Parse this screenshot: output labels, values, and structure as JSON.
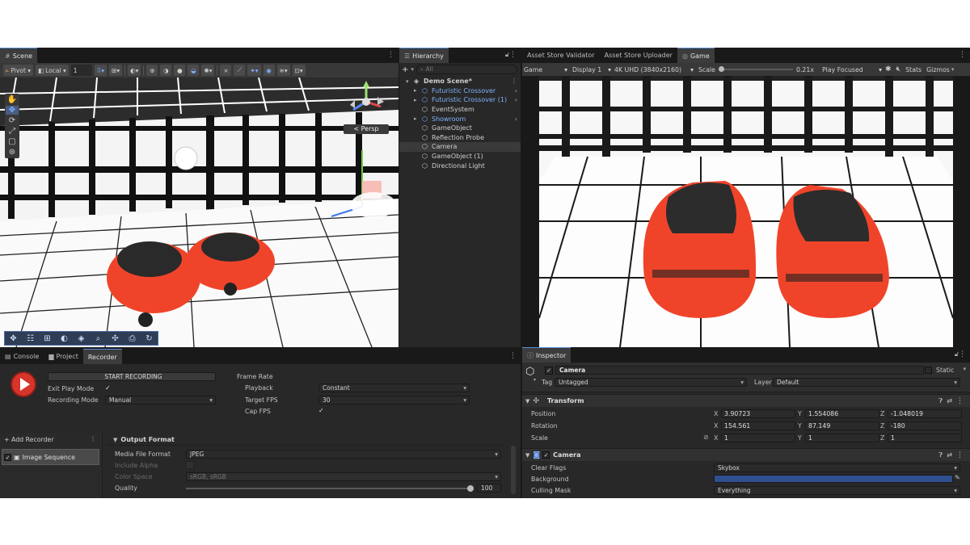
{
  "scene": {
    "tab": "Scene",
    "toolbar": {
      "pivot": "Pivot",
      "local": "Local",
      "grid_snap": "1"
    },
    "persp_label": "< Persp",
    "gizmo_y": "y",
    "gizmo_x": "x"
  },
  "hierarchy": {
    "tab": "Hierarchy",
    "search_placeholder": "All",
    "add_symbol": "+",
    "items": [
      {
        "label": "Demo Scene*",
        "depth": 0,
        "kind": "scene"
      },
      {
        "label": "Futuristic Crossover",
        "depth": 1,
        "kind": "prefab"
      },
      {
        "label": "Futuristic Crossover (1)",
        "depth": 1,
        "kind": "prefab"
      },
      {
        "label": "EventSystem",
        "depth": 1,
        "kind": "go"
      },
      {
        "label": "Showroom",
        "depth": 1,
        "kind": "prefab"
      },
      {
        "label": "GameObject",
        "depth": 1,
        "kind": "go"
      },
      {
        "label": "Reflection Probe",
        "depth": 1,
        "kind": "go"
      },
      {
        "label": "Camera",
        "depth": 1,
        "kind": "go"
      },
      {
        "label": "GameObject (1)",
        "depth": 1,
        "kind": "go"
      },
      {
        "label": "Directional Light",
        "depth": 1,
        "kind": "go"
      }
    ]
  },
  "game": {
    "tabs": [
      "Asset Store Validator",
      "Asset Store Uploader",
      "Game"
    ],
    "toolbar": {
      "mode": "Game",
      "display": "Display 1",
      "resolution": "4K UHD (3840x2160)",
      "scale_label": "Scale",
      "scale_value": "0.21x",
      "play_mode": "Play Focused",
      "stats": "Stats",
      "gizmos": "Gizmos"
    }
  },
  "bottom_tabs": [
    "Console",
    "Project",
    "Recorder"
  ],
  "recorder": {
    "start_label": "START RECORDING",
    "exit_play_mode_label": "Exit Play Mode",
    "exit_play_mode_check": "✓",
    "recording_mode_label": "Recording Mode",
    "recording_mode_value": "Manual",
    "frame_rate_label": "Frame Rate",
    "playback_label": "Playback",
    "playback_value": "Constant",
    "target_fps_label": "Target FPS",
    "target_fps_value": "30",
    "cap_fps_label": "Cap FPS",
    "cap_fps_check": "✓",
    "add_recorder": "+ Add Recorder",
    "recorder_item": "Image Sequence",
    "output_format_label": "Output Format",
    "media_file_format_label": "Media File Format",
    "media_file_format_value": "JPEG",
    "include_alpha_label": "Include Alpha",
    "color_space_label": "Color Space",
    "color_space_value": "sRGB, sRGB",
    "quality_label": "Quality",
    "quality_value": "100",
    "quality_fraction": 1.0
  },
  "inspector": {
    "tab": "Inspector",
    "object_name": "Camera",
    "static_label": "Static",
    "tag_label": "Tag",
    "tag_value": "Untagged",
    "layer_label": "Layer",
    "layer_value": "Default",
    "transform": {
      "title": "Transform",
      "position_label": "Position",
      "position": {
        "x": "3.90723",
        "y": "1.554086",
        "z": "-1.048019"
      },
      "rotation_label": "Rotation",
      "rotation": {
        "x": "154.561",
        "y": "87.149",
        "z": "-180"
      },
      "scale_label": "Scale",
      "scale": {
        "x": "1",
        "y": "1",
        "z": "1"
      }
    },
    "camera": {
      "title": "Camera",
      "clear_flags_label": "Clear Flags",
      "clear_flags_value": "Skybox",
      "background_label": "Background",
      "background_color": "#2f4f8f",
      "culling_mask_label": "Culling Mask",
      "culling_mask_value": "Everything"
    },
    "axis_x": "X",
    "axis_y": "Y",
    "axis_z": "Z"
  },
  "colors": {
    "car_red": "#f0442a",
    "accent_blue": "#5a8ed8",
    "record_red": "#d6352a"
  }
}
